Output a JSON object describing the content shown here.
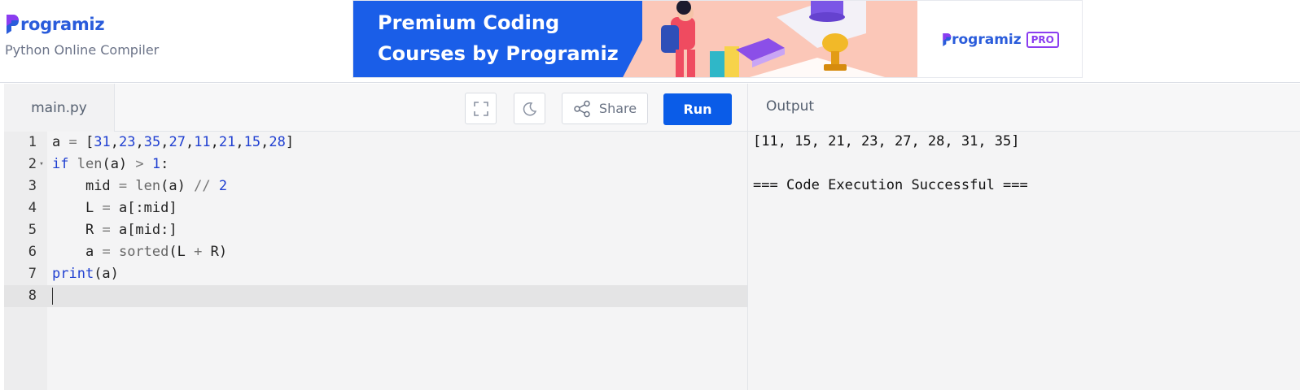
{
  "header": {
    "brand": "rogramiz",
    "subtitle": "Python Online Compiler"
  },
  "ad": {
    "title_line1": "Premium Coding",
    "title_line2": "Courses by Programiz",
    "brand": "rogramiz",
    "pro_badge": "PRO"
  },
  "editor": {
    "tab_label": "main.py",
    "share_label": "Share",
    "run_label": "Run",
    "lines": [
      {
        "num": "1",
        "text": "a = [31,23,35,27,11,21,15,28]"
      },
      {
        "num": "2",
        "text": "if len(a) > 1:"
      },
      {
        "num": "3",
        "text": "    mid = len(a) // 2"
      },
      {
        "num": "4",
        "text": "    L = a[:mid]"
      },
      {
        "num": "5",
        "text": "    R = a[mid:]"
      },
      {
        "num": "6",
        "text": "    a = sorted(L + R)"
      },
      {
        "num": "7",
        "text": "print(a)"
      },
      {
        "num": "8",
        "text": ""
      }
    ]
  },
  "output": {
    "title": "Output",
    "lines": [
      "[11, 15, 21, 23, 27, 28, 31, 35]",
      "",
      "=== Code Execution Successful ==="
    ]
  },
  "colors": {
    "accent": "#0a5ce8",
    "brand_blue": "#2a5cdb",
    "brand_purple": "#8b3df0"
  }
}
